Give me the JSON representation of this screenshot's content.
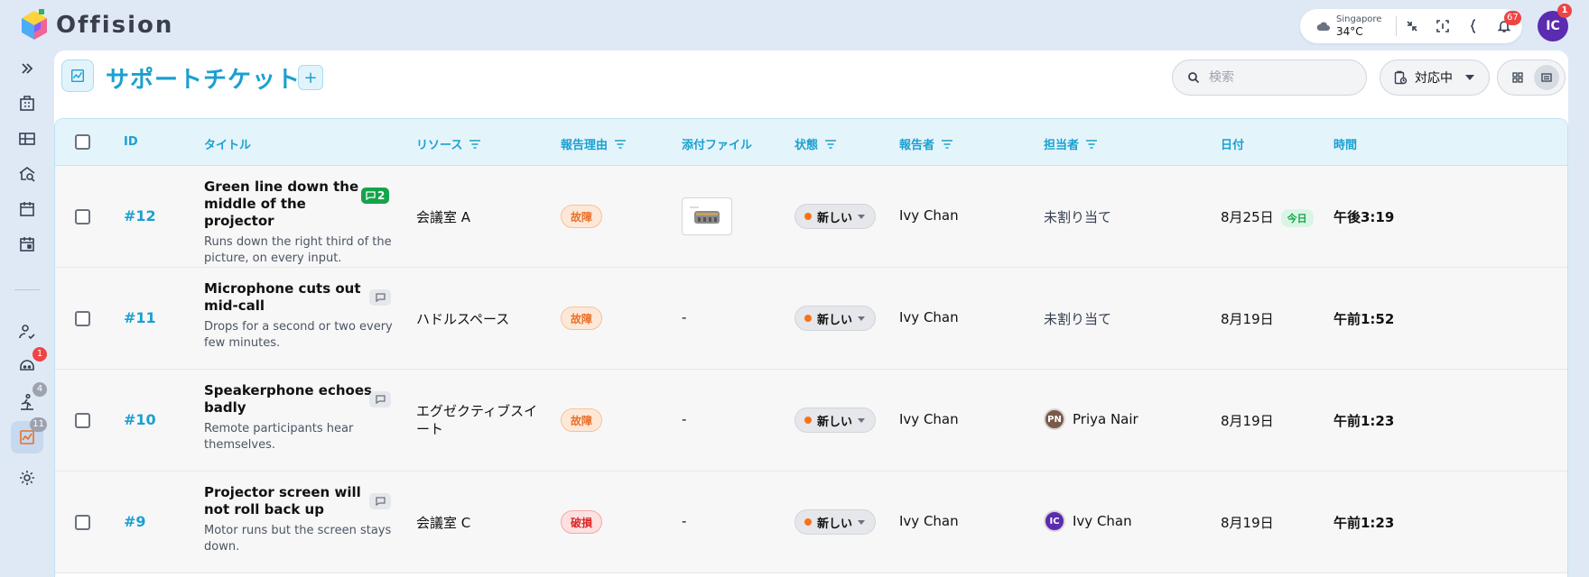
{
  "app": {
    "name": "Offision"
  },
  "topbar": {
    "weather": {
      "city": "Singapore",
      "temp": "34°C"
    },
    "notifications_count": "67",
    "user_initials": "IC",
    "user_badge": "1"
  },
  "sidebar": {
    "items": [
      {
        "icon": "expand-icon"
      },
      {
        "icon": "office-icon"
      },
      {
        "icon": "rooms-icon"
      },
      {
        "icon": "search-space-icon"
      },
      {
        "icon": "calendar-icon"
      },
      {
        "icon": "calendar-event-icon"
      },
      {
        "icon": "visitor-icon"
      },
      {
        "icon": "assistant-icon",
        "badge": "1"
      },
      {
        "icon": "walking-icon",
        "badge": "4"
      },
      {
        "icon": "support-icon",
        "badge": "11",
        "active": true
      },
      {
        "icon": "settings-icon"
      }
    ]
  },
  "header": {
    "title": "サポートチケット",
    "add_label": "+",
    "search_placeholder": "検索",
    "filter_label": "対応中"
  },
  "table": {
    "columns": {
      "id": "ID",
      "title": "タイトル",
      "resource": "リソース",
      "reason": "報告理由",
      "attachment": "添付ファイル",
      "state": "状態",
      "reporter": "報告者",
      "assignee": "担当者",
      "date": "日付",
      "time": "時間"
    },
    "rows": [
      {
        "id": "#12",
        "title": "Green line down the middle of the projector",
        "desc": "Runs down the right third of the picture, on every input.",
        "comments": "2",
        "resource": "会議室 A",
        "reason": "故障",
        "attachment": "",
        "state": "新しい",
        "reporter": "Ivy Chan",
        "assignee": "未割り当て",
        "assignee_initials": "",
        "date": "8月25日",
        "today": "今日",
        "time": "午後3:19"
      },
      {
        "id": "#11",
        "title": "Microphone cuts out mid-call",
        "desc": "Drops for a second or two every few minutes.",
        "comments": "",
        "resource": "ハドルスペース",
        "reason": "故障",
        "attachment": "-",
        "state": "新しい",
        "reporter": "Ivy Chan",
        "assignee": "未割り当て",
        "assignee_initials": "",
        "date": "8月19日",
        "time": "午前1:52"
      },
      {
        "id": "#10",
        "title": "Speakerphone echoes badly",
        "desc": "Remote participants hear themselves.",
        "comments": "",
        "resource": "エグゼクティブスイート",
        "reason": "故障",
        "attachment": "-",
        "state": "新しい",
        "reporter": "Ivy Chan",
        "assignee": "Priya Nair",
        "assignee_initials": "PN",
        "date": "8月19日",
        "time": "午前1:23"
      },
      {
        "id": "#9",
        "title": "Projector screen will not roll back up",
        "desc": "Motor runs but the screen stays down.",
        "comments": "",
        "resource": "会議室 C",
        "reason": "破損",
        "attachment": "-",
        "state": "新しい",
        "reporter": "Ivy Chan",
        "assignee": "Ivy Chan",
        "assignee_initials": "IC",
        "date": "8月19日",
        "time": "午前1:23"
      }
    ]
  },
  "colors": {
    "accent": "#1ba0d0",
    "fault": "#e8702a",
    "broken": "#dc2626",
    "badge": "#ef4444",
    "comment_green": "#16a34a"
  }
}
